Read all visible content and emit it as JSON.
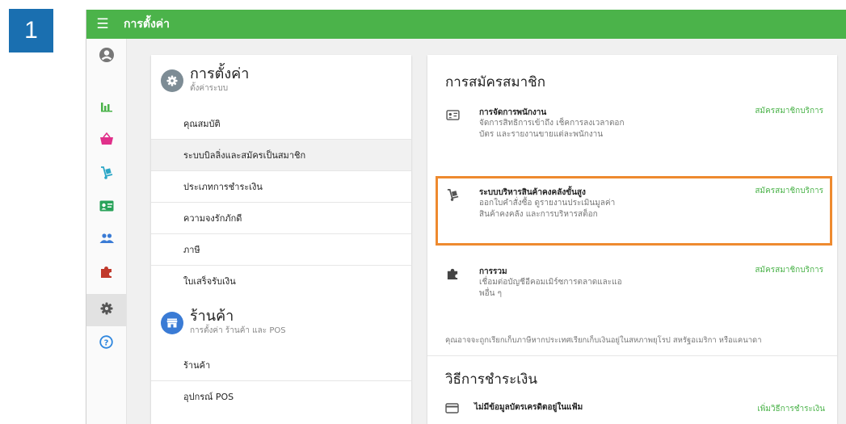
{
  "step_number": "1",
  "colors": {
    "brand": "#4bb34a",
    "step_badge": "#1a6fb0",
    "highlight_border": "#ee8a2f"
  },
  "topbar": {
    "menu_icon": "hamburger-icon",
    "title": "การตั้งค่า"
  },
  "sidebar": {
    "items": [
      {
        "icon": "account-circle-icon",
        "active": false
      },
      {
        "icon": "bar-chart-icon",
        "active": false
      },
      {
        "icon": "basket-icon",
        "active": false
      },
      {
        "icon": "dolly-icon",
        "active": false
      },
      {
        "icon": "id-card-icon",
        "active": false
      },
      {
        "icon": "people-icon",
        "active": false
      },
      {
        "icon": "puzzle-icon",
        "active": false
      },
      {
        "icon": "gear-icon",
        "active": true
      },
      {
        "icon": "help-icon",
        "active": false
      }
    ]
  },
  "settings_section": {
    "title": "การตั้งค่า",
    "subtitle": "ตั้งค่าระบบ",
    "items": [
      {
        "label": "คุณสมบัติ"
      },
      {
        "label": "ระบบบิลลิ่งและสมัครเป็นสมาชิก",
        "active": true
      },
      {
        "label": "ประเภทการชำระเงิน"
      },
      {
        "label": "ความจงรักภักดี"
      },
      {
        "label": "ภาษี"
      },
      {
        "label": "ใบเสร็จรับเงิน"
      }
    ]
  },
  "store_section": {
    "title": "ร้านค้า",
    "subtitle": "การตั้งค่า ร้านค้า และ POS",
    "items": [
      {
        "label": "ร้านค้า"
      },
      {
        "label": "อุปกรณ์ POS"
      }
    ]
  },
  "subscriptions": {
    "title": "การสมัครสมาชิก",
    "items": [
      {
        "icon": "id-card-icon",
        "name": "การจัดการพนักงาน",
        "description": "จัดการสิทธิการเข้าถึง เช็คการลงเวลาตอกบัตร และรายงานขายแต่ละพนักงาน",
        "action": "สมัครสมาชิกบริการ"
      },
      {
        "icon": "dolly-icon",
        "name": "ระบบบริหารสินค้าคงคลังขั้นสูง",
        "description": "ออกใบคำสั่งซื้อ ดูรายงานประเมินมูลค่าสินค้าคงคลัง และการบริหารสต็อก",
        "action": "สมัครสมาชิกบริการ",
        "highlighted": true
      },
      {
        "icon": "puzzle-icon",
        "name": "การรวม",
        "description": "เชื่อมต่อบัญชีอีคอมเมิร์ซการตลาดและแอพอื่น ๆ",
        "action": "สมัครสมาชิกบริการ"
      }
    ],
    "note": "คุณอาจจะถูกเรียกเก็บภาษีหากประเทศเรียกเก็บเงินอยู่ในสหภาพยุโรป สหรัฐอเมริกา หรือแคนาดา"
  },
  "payment": {
    "title": "วิธีการชำระเงิน",
    "icon": "credit-card-icon",
    "empty_text": "ไม่มีข้อมูลบัตรเครดิตอยู่ในแฟ้ม",
    "add_label": "เพิ่มวิธีการชำระเงิน"
  }
}
